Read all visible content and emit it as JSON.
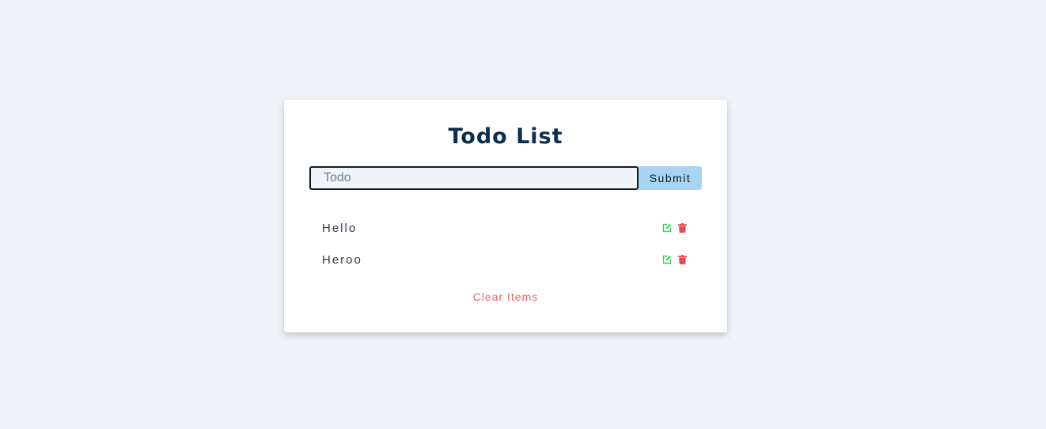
{
  "card": {
    "title": "Todo List"
  },
  "form": {
    "input_value": "",
    "input_placeholder": "Todo",
    "submit_label": "Submit"
  },
  "items": [
    {
      "label": "Hello",
      "edit_icon": "edit-icon",
      "delete_icon": "trash-icon"
    },
    {
      "label": "Heroo",
      "edit_icon": "edit-icon",
      "delete_icon": "trash-icon"
    }
  ],
  "clear_label": "Clear Items",
  "colors": {
    "page_background": "#f0f4f8",
    "title": "#0c2d4e",
    "submit_background": "#a8d4f3",
    "edit_icon": "#37d35a",
    "delete_icon": "#e14d57",
    "clear_text": "#e16561"
  }
}
